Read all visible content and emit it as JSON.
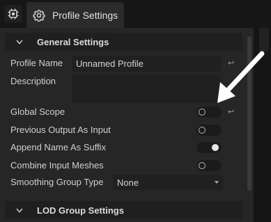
{
  "tab": {
    "title": "Profile Settings"
  },
  "sections": {
    "general": "General Settings",
    "lod": "LOD Group Settings"
  },
  "fields": {
    "profile_name": {
      "label": "Profile Name",
      "value": "Unnamed Profile"
    },
    "description": {
      "label": "Description",
      "value": ""
    },
    "global_scope": {
      "label": "Global Scope",
      "on": false
    },
    "prev_output": {
      "label": "Previous Output As Input",
      "on": false
    },
    "append_name": {
      "label": "Append Name As Suffix",
      "on": true
    },
    "combine_meshes": {
      "label": "Combine Input Meshes",
      "on": false
    },
    "smoothing": {
      "label": "Smoothing Group Type",
      "value": "None"
    }
  },
  "icons": {
    "tab_left": "chip-icon",
    "tab_active": "gear-icon",
    "section_general": "chevron-down-icon",
    "section_lod": "chevron-down-icon",
    "reset": "reset-arrow-icon",
    "annotation": "white-arrow"
  },
  "colors": {
    "background": "#262626",
    "header": "#1f1f1f",
    "toggle_on_knob": "#e6e6e6"
  }
}
